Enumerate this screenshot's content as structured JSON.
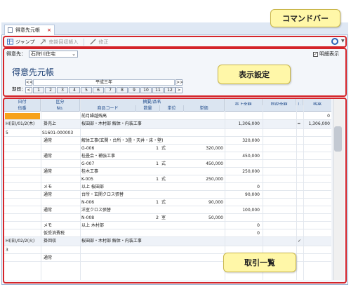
{
  "tab": {
    "title": "得意先元帳",
    "close": "×"
  },
  "commandbar": {
    "jump": "ジャンプ",
    "invoice": "売掛回収帳入",
    "edit": "修正"
  },
  "display": {
    "customer_label": "得意先：",
    "customer_value": "石狩川住宅",
    "detail_toggle": "明細表示",
    "detail_checked": "✓"
  },
  "page_title": "得意先元帳",
  "period": {
    "label": "期間：",
    "year": "平成三年",
    "prev": "<<",
    "next": ">>",
    "left": "<",
    "right": ">",
    "months": [
      "1",
      "2",
      "3",
      "4",
      "5",
      "6",
      "7",
      "8",
      "9",
      "10",
      "11",
      "12"
    ]
  },
  "table": {
    "header1": {
      "date": "日付",
      "kubun": "区分",
      "summary": "摘要/品名",
      "sales": "売上金額",
      "recv": "回収金額",
      "l": "し",
      "balance": "残高"
    },
    "header2": {
      "slip": "伝番",
      "no": "No.",
      "code": "商品コード",
      "qty": "数量",
      "unit": "単位",
      "price": "単価"
    },
    "rows": [
      {
        "summary": "前月繰越残高",
        "balance": "0"
      },
      {
        "date": "H(旧)/01/2(木)",
        "kubun": "掛売上",
        "summary": "桜田部・木村部 解体・内装工事",
        "sales": "1,306,000",
        "l": "━",
        "balance": "1,306,000"
      },
      {
        "date": "5",
        "no": "S1601-000003"
      },
      {
        "kubun": "通常",
        "summary": "解体工事(玄関・台所・3畳・天井・床・壁)",
        "sales": "320,000"
      },
      {
        "code": "G-006",
        "qty": "1",
        "unit": "式",
        "price": "320,000"
      },
      {
        "kubun": "通常",
        "summary": "桂畳会・補強工事",
        "sales": "450,000"
      },
      {
        "code": "G-007",
        "qty": "1",
        "unit": "式",
        "price": "450,000"
      },
      {
        "kubun": "通常",
        "summary": "桂木工事",
        "sales": "250,000"
      },
      {
        "code": "K-005",
        "qty": "1",
        "unit": "式",
        "price": "250,000"
      },
      {
        "kubun": "メモ",
        "summary": "以上 桜田部",
        "sales": "0"
      },
      {
        "kubun": "通常",
        "summary": "台所・玄関クロス張替",
        "sales": "90,000"
      },
      {
        "code": "N-006",
        "qty": "1",
        "unit": "式",
        "price": "90,000"
      },
      {
        "kubun": "通常",
        "summary": "洋室クロス張替",
        "sales": "100,000"
      },
      {
        "code": "N-008",
        "qty": "2",
        "unit": "室",
        "price": "50,000"
      },
      {
        "kubun": "メモ",
        "summary": "以上 木村部",
        "sales": "0"
      },
      {
        "kubun": "仮受消費税",
        "sales": "0"
      },
      {
        "date": "H(旧)/02/2(火)",
        "kubun": "掛回収",
        "summary": "桜田部・木村部 解体・内装工事",
        "l": "✓"
      },
      {
        "date": "3"
      },
      {
        "kubun": "通常"
      }
    ]
  },
  "callouts": {
    "commandbar": "コマンドバー",
    "display": "表示設定",
    "list": "取引一覧"
  }
}
